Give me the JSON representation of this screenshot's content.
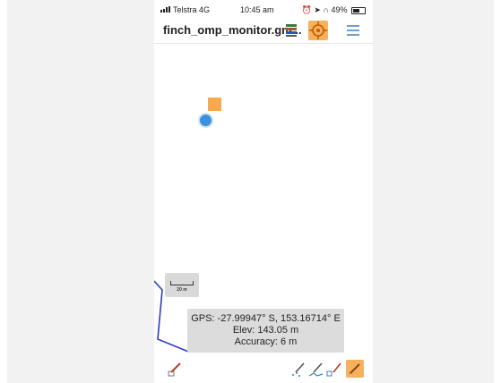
{
  "status_bar": {
    "carrier": "Telstra 4G",
    "time": "10:45 am",
    "battery": "49%"
  },
  "header": {
    "title": "finch_omp_monitor.gm..."
  },
  "map": {
    "scale_label": "20 m"
  },
  "info": {
    "gps": "GPS: -27.99947° S, 153.16714° E",
    "elev": "Elev: 143.05 m",
    "accuracy": "Accuracy: 6 m"
  },
  "colors": {
    "accent": "#f6b15f",
    "gps_dot": "#3b8fe0",
    "track": "#2d3ec4"
  }
}
